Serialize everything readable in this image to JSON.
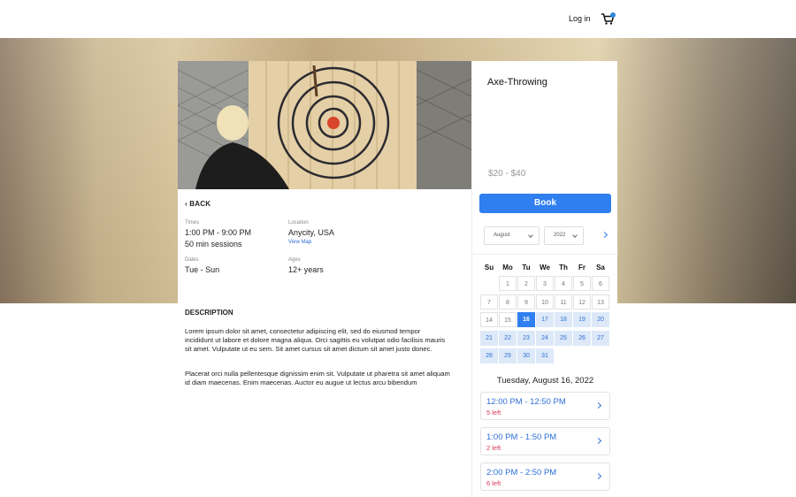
{
  "header": {
    "login_label": "Log in",
    "cart_icon": "cart-icon"
  },
  "event": {
    "title": "Axe-Throwing",
    "price": "$20 - $40",
    "book_label": "Book",
    "back_label": "BACK",
    "times_label": "Times",
    "times_value": "1:00 PM - 9:00 PM",
    "sessions_value": "50 min sessions",
    "location_label": "Location",
    "location_value": "Anycity, USA",
    "view_map_label": "View Map",
    "dates_label": "Dates",
    "dates_value": "Tue - Sun",
    "ages_label": "Ages",
    "ages_value": "12+ years",
    "description_heading": "DESCRIPTION",
    "description_p1": "Lorem ipsum dolor sit amet, consectetur adipiscing elit, sed do eiusmod tempor incididunt ut labore et dolore magna aliqua. Orci sagittis eu volutpat odio facilisis mauris sit amet. Vulputate ut eu sem. Sit amet cursus sit amet dictum sit amet justo donec.",
    "description_p2": "Placerat orci nulla pellentesque dignissim enim sit. Vulputate ut pharetra sit amet aliquam id diam maecenas. Enim maecenas. Auctor eu augue ut lectus arcu bibendum"
  },
  "calendar": {
    "month": "August",
    "year": "2022",
    "weekdays": [
      "Su",
      "Mo",
      "Tu",
      "We",
      "Th",
      "Fr",
      "Sa"
    ],
    "weeks": [
      [
        "",
        "1",
        "2",
        "3",
        "4",
        "5",
        "6"
      ],
      [
        "7",
        "8",
        "9",
        "10",
        "11",
        "12",
        "13"
      ],
      [
        "14",
        "15",
        "16",
        "17",
        "18",
        "19",
        "20"
      ],
      [
        "21",
        "22",
        "23",
        "24",
        "25",
        "26",
        "27"
      ],
      [
        "28",
        "29",
        "30",
        "31",
        "",
        "",
        ""
      ]
    ],
    "selected_day": "16",
    "selected_date_label": "Tuesday, August 16, 2022"
  },
  "slots": [
    {
      "time": "12:00 PM - 12:50 PM",
      "left": "5 left"
    },
    {
      "time": "1:00 PM - 1:50 PM",
      "left": "2 left"
    },
    {
      "time": "2:00 PM - 2:50 PM",
      "left": "6 left"
    }
  ]
}
